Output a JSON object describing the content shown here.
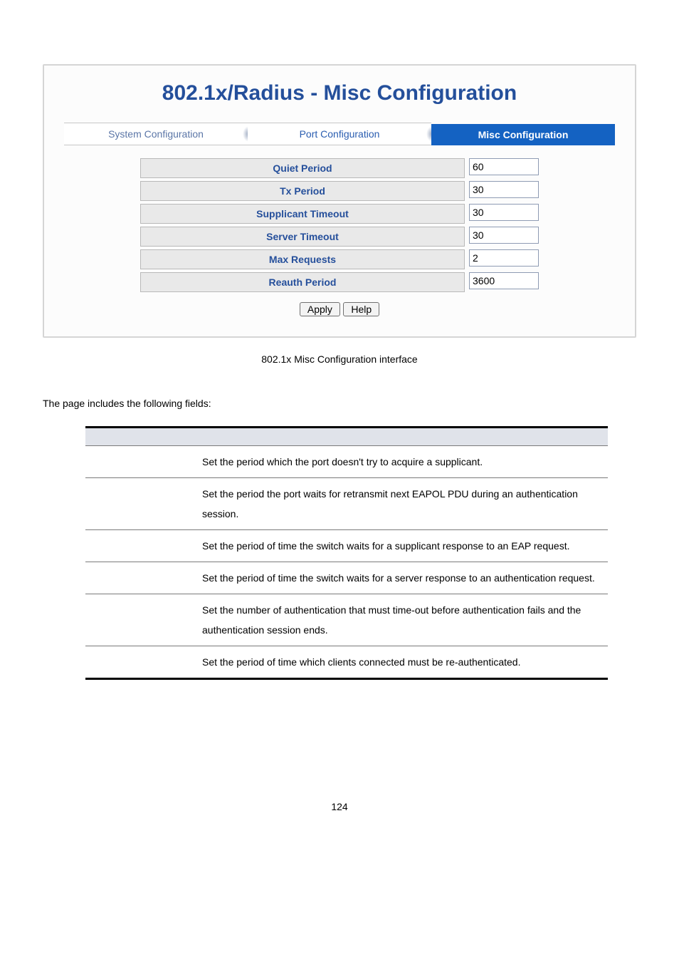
{
  "panel": {
    "title": "802.1x/Radius - Misc Configuration",
    "tabs": {
      "system": "System Configuration",
      "port": "Port Configuration",
      "misc": "Misc Configuration"
    },
    "rows": [
      {
        "label": "Quiet Period",
        "value": "60"
      },
      {
        "label": "Tx Period",
        "value": "30"
      },
      {
        "label": "Supplicant Timeout",
        "value": "30"
      },
      {
        "label": "Server Timeout",
        "value": "30"
      },
      {
        "label": "Max Requests",
        "value": "2"
      },
      {
        "label": "Reauth Period",
        "value": "3600"
      }
    ],
    "buttons": {
      "apply": "Apply",
      "help": "Help"
    }
  },
  "caption": "802.1x Misc Configuration interface",
  "intro": "The page includes the following fields:",
  "desc": [
    {
      "object": "",
      "text": "Set the period which the port doesn't try to acquire a supplicant."
    },
    {
      "object": "",
      "text": "Set the period the port waits for retransmit next EAPOL PDU during an authentication session."
    },
    {
      "object": "",
      "text": "Set the period of time the switch waits for a supplicant response to an EAP request."
    },
    {
      "object": "",
      "text": "Set the period of time the switch waits for a server response to an authentication request."
    },
    {
      "object": "",
      "text": "Set the number of authentication that must time-out before authentication fails and the authentication session ends."
    },
    {
      "object": "",
      "text": "Set the period of time which clients connected must be re-authenticated."
    }
  ],
  "pagenum": "124"
}
